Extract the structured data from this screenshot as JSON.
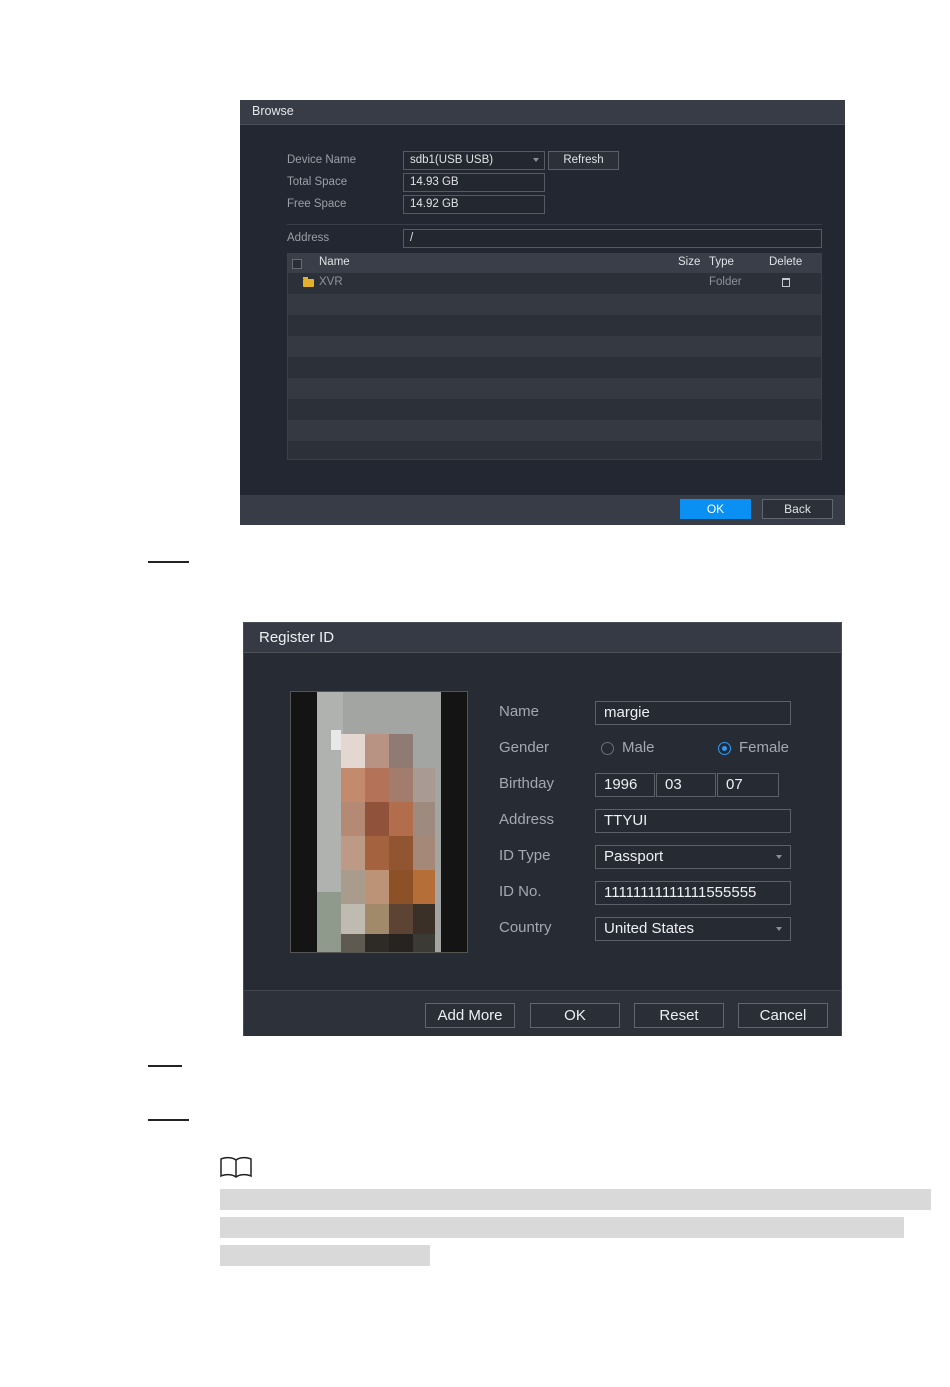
{
  "browse": {
    "title": "Browse",
    "device_name_label": "Device Name",
    "device_name_value": "sdb1(USB USB)",
    "refresh_label": "Refresh",
    "total_space_label": "Total Space",
    "total_space_value": "14.93 GB",
    "free_space_label": "Free Space",
    "free_space_value": "14.92 GB",
    "address_label": "Address",
    "address_value": "/",
    "columns": {
      "name": "Name",
      "size": "Size",
      "type": "Type",
      "delete": "Delete"
    },
    "rows": [
      {
        "name": "XVR",
        "size": "",
        "type": "Folder"
      }
    ],
    "ok_label": "OK",
    "back_label": "Back"
  },
  "register": {
    "title": "Register ID",
    "name_label": "Name",
    "name_value": "margie",
    "gender_label": "Gender",
    "gender_male": "Male",
    "gender_female": "Female",
    "gender_selected": "Female",
    "birthday_label": "Birthday",
    "birthday_year": "1996",
    "birthday_month": "03",
    "birthday_day": "07",
    "address_label": "Address",
    "address_value": "TTYUI",
    "id_type_label": "ID Type",
    "id_type_value": "Passport",
    "id_no_label": "ID No.",
    "id_no_value": "11111111111111555555",
    "country_label": "Country",
    "country_value": "United States",
    "buttons": {
      "add_more": "Add More",
      "ok": "OK",
      "reset": "Reset",
      "cancel": "Cancel"
    }
  },
  "colors": {
    "accent": "#0a8ff3",
    "dialog_bg": "#232731",
    "folder": "#e3b12a"
  },
  "icons": [
    "folder-icon",
    "trash-icon",
    "book-icon",
    "chevron-down-icon"
  ]
}
